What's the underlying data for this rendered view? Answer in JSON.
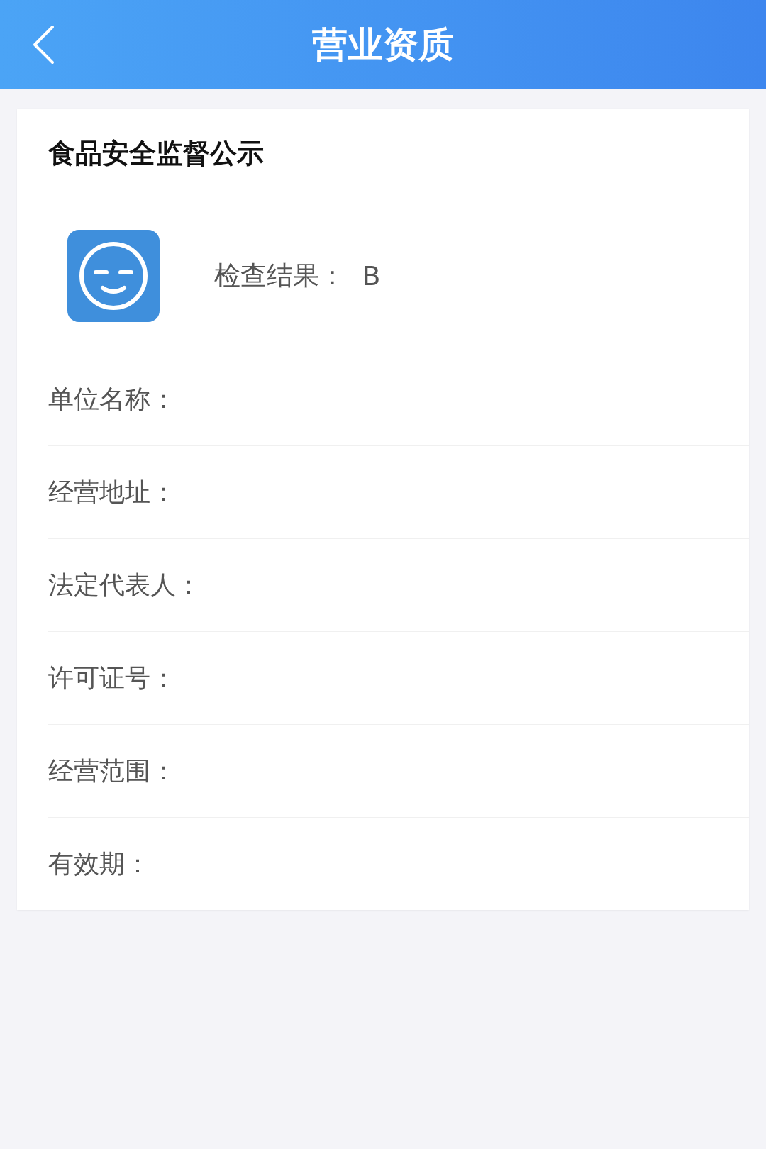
{
  "header": {
    "title": "营业资质"
  },
  "card": {
    "title": "食品安全监督公示",
    "result": {
      "label": "检查结果：",
      "value": "B"
    },
    "fields": [
      {
        "label": "单位名称："
      },
      {
        "label": "经营地址："
      },
      {
        "label": "法定代表人："
      },
      {
        "label": "许可证号："
      },
      {
        "label": "经营范围："
      },
      {
        "label": "有效期："
      }
    ]
  }
}
